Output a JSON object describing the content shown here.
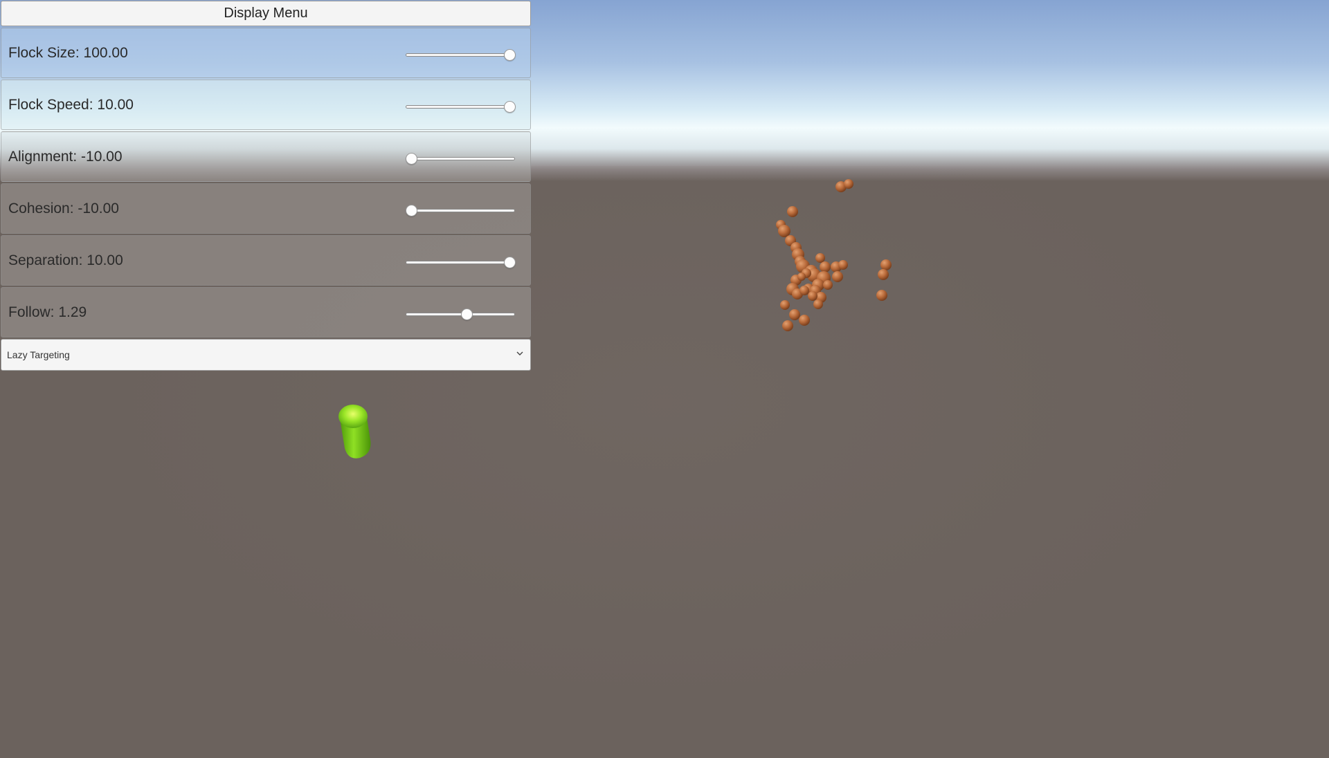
{
  "menu": {
    "header_label": "Display Menu",
    "rows": [
      {
        "label": "Flock Size: 100.00",
        "value": 100.0,
        "min": 0,
        "max": 100
      },
      {
        "label": "Flock Speed: 10.00",
        "value": 10.0,
        "min": 0,
        "max": 10
      },
      {
        "label": "Alignment: -10.00",
        "value": -10.0,
        "min": -10,
        "max": 10
      },
      {
        "label": "Cohesion: -10.00",
        "value": -10.0,
        "min": -10,
        "max": 10
      },
      {
        "label": "Separation: 10.00",
        "value": 10.0,
        "min": -10,
        "max": 10
      },
      {
        "label": "Follow: 1.29",
        "value": 1.29,
        "min": -10,
        "max": 10
      }
    ],
    "dropdown": {
      "selected": "Lazy Targeting",
      "icon": "chevron-down-icon"
    }
  },
  "scene": {
    "sky_color_top": "#86a4d2",
    "horizon_color": "#f2fbfd",
    "ground_color": "#6b625d",
    "target_color": "#7ccf1d",
    "boid_color": "#b86a3a"
  }
}
